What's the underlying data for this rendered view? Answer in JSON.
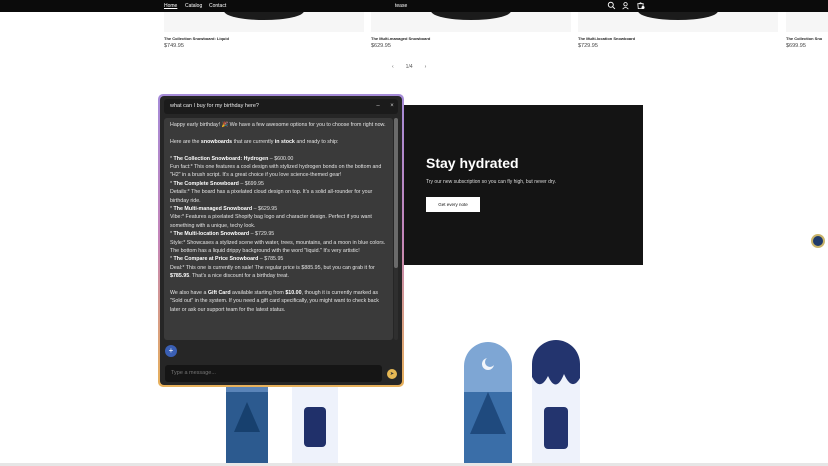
{
  "nav": {
    "links": [
      "Home",
      "Catalog",
      "Contact"
    ],
    "brand": "tease"
  },
  "products_top": [
    {
      "title": "The Collection Snowboard: Liquid",
      "price": "$749.95"
    },
    {
      "title": "The Multi-managed Snowboard",
      "price": "$629.95"
    },
    {
      "title": "The Multi-location Snowboard",
      "price": "$729.95"
    },
    {
      "title": "The Collection Sno",
      "price": "$699.95"
    }
  ],
  "pager": {
    "prev": "‹",
    "label": "1/4",
    "next": "›"
  },
  "promo": {
    "title": "Stay hydrated",
    "text": "Try our new subscription so you can fly high, but never dry.",
    "button": "Get every note"
  },
  "chat": {
    "question": "what can I buy for my birthday here?",
    "minimize": "–",
    "close": "×",
    "input_placeholder": "Type a message...",
    "plus": "+",
    "send": "➤",
    "intro": "Happy early birthday! 🎉 We have a few awesome options for you to choose from right now.",
    "lead_pre": "Here are the ",
    "lead_b1": "snowboards",
    "lead_mid": " that are currently ",
    "lead_b2": "in stock",
    "lead_post": " and ready to ship:",
    "items": [
      {
        "name": "The Collection Snowboard: Hydrogen",
        "price": " – $600.00",
        "text": "Fun fact:* This one features a cool design with stylized hydrogen bonds on the bottom and \"H2\" in a brush script. It's a great choice if you love science-themed gear!"
      },
      {
        "name": "The Complete Snowboard",
        "price": " – $699.95",
        "text": "Details:* The board has a pixelated cloud design on top. It's a solid all-rounder for your birthday ride."
      },
      {
        "name": "The Multi-managed Snowboard",
        "price": " – $629.95",
        "text": "Vibe:* Features a pixelated Shopify bag logo and character design. Perfect if you want something with a unique, techy look."
      },
      {
        "name": "The Multi-location Snowboard",
        "price": " – $729.95",
        "text": "Style:* Showcases a stylized scene with water, trees, mountains, and a moon in blue colors. The bottom has a liquid drippy background with the word \"liquid.\" It's very artistic!"
      }
    ],
    "deal_name": "The Compare at Price Snowboard",
    "deal_price": " – $785.95",
    "deal_pre": "Deal:* This one is currently on sale! The regular price is $885.95, but you can grab it for ",
    "deal_bold": "$785.95",
    "deal_post": ". That's a nice discount for a birthday treat.",
    "gift_pre": "We also have a ",
    "gift_b1": "Gift Card",
    "gift_mid": " available starting from ",
    "gift_b2": "$10.00",
    "gift_post": ", though it is currently marked as \"Sold out\" in the system. If you need a gift card specifically, you might want to check back later or ask our support team for the latest status."
  }
}
